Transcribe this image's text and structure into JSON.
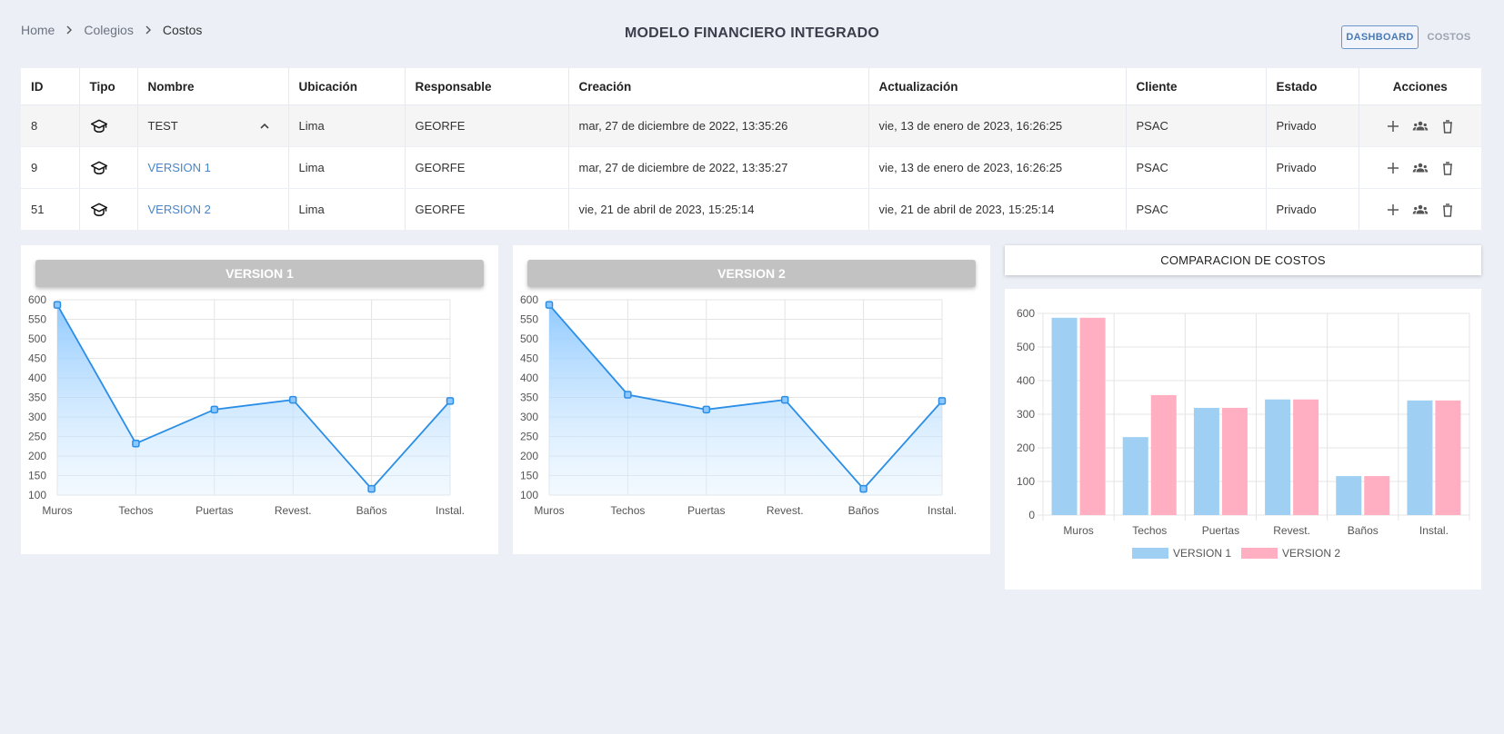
{
  "breadcrumb": {
    "home": "Home",
    "colegios": "Colegios",
    "current": "Costos"
  },
  "title": "MODELO FINANCIERO INTEGRADO",
  "buttons": {
    "dashboard": "DASHBOARD",
    "costos": "COSTOS"
  },
  "table": {
    "headers": [
      "ID",
      "Tipo",
      "Nombre",
      "Ubicación",
      "Responsable",
      "Creación",
      "Actualización",
      "Cliente",
      "Estado",
      "Acciones"
    ],
    "rows": [
      {
        "id": "8",
        "tipo": "school-icon",
        "nombre": "TEST",
        "ubicacion": "Lima",
        "responsable": "GEORFE",
        "creacion": "mar, 27 de diciembre de 2022, 13:35:26",
        "actualizacion": "vie, 13 de enero de 2023, 16:26:25",
        "cliente": "PSAC",
        "estado": "Privado"
      },
      {
        "id": "9",
        "tipo": "school-icon",
        "nombre": "VERSION 1",
        "ubicacion": "Lima",
        "responsable": "GEORFE",
        "creacion": "mar, 27 de diciembre de 2022, 13:35:27",
        "actualizacion": "vie, 13 de enero de 2023, 16:26:25",
        "cliente": "PSAC",
        "estado": "Privado"
      },
      {
        "id": "51",
        "tipo": "school-icon",
        "nombre": "VERSION 2",
        "ubicacion": "Lima",
        "responsable": "GEORFE",
        "creacion": "vie, 21 de abril de 2023, 15:25:14",
        "actualizacion": "vie, 21 de abril de 2023, 15:25:14",
        "cliente": "PSAC",
        "estado": "Privado"
      }
    ]
  },
  "chart_data": [
    {
      "type": "area",
      "title": "VERSION 1",
      "categories": [
        "Muros",
        "Techos",
        "Puertas",
        "Revest.",
        "Baños",
        "Instal."
      ],
      "values": [
        587,
        232,
        319,
        344,
        116,
        341
      ],
      "ylim": [
        100,
        600
      ],
      "yticks": [
        100,
        150,
        200,
        250,
        300,
        350,
        400,
        450,
        500,
        550,
        600
      ],
      "grid": true,
      "color": "#2b8ee6"
    },
    {
      "type": "area",
      "title": "VERSION 2",
      "categories": [
        "Muros",
        "Techos",
        "Puertas",
        "Revest.",
        "Baños",
        "Instal."
      ],
      "values": [
        587,
        357,
        319,
        344,
        116,
        341
      ],
      "ylim": [
        100,
        600
      ],
      "yticks": [
        100,
        150,
        200,
        250,
        300,
        350,
        400,
        450,
        500,
        550,
        600
      ],
      "grid": true,
      "color": "#2b8ee6"
    },
    {
      "type": "bar",
      "title": "COMPARACION DE COSTOS",
      "categories": [
        "Muros",
        "Techos",
        "Puertas",
        "Revest.",
        "Baños",
        "Instal."
      ],
      "series": [
        {
          "name": "VERSION 1",
          "values": [
            587,
            232,
            319,
            344,
            116,
            341
          ],
          "color": "#9fd0f3"
        },
        {
          "name": "VERSION 2",
          "values": [
            587,
            357,
            319,
            344,
            116,
            341
          ],
          "color": "#ffafc1"
        }
      ],
      "ylim": [
        0,
        600
      ],
      "yticks": [
        0,
        100,
        200,
        300,
        400,
        500,
        600
      ],
      "grid": true,
      "legend": "bottom"
    }
  ]
}
